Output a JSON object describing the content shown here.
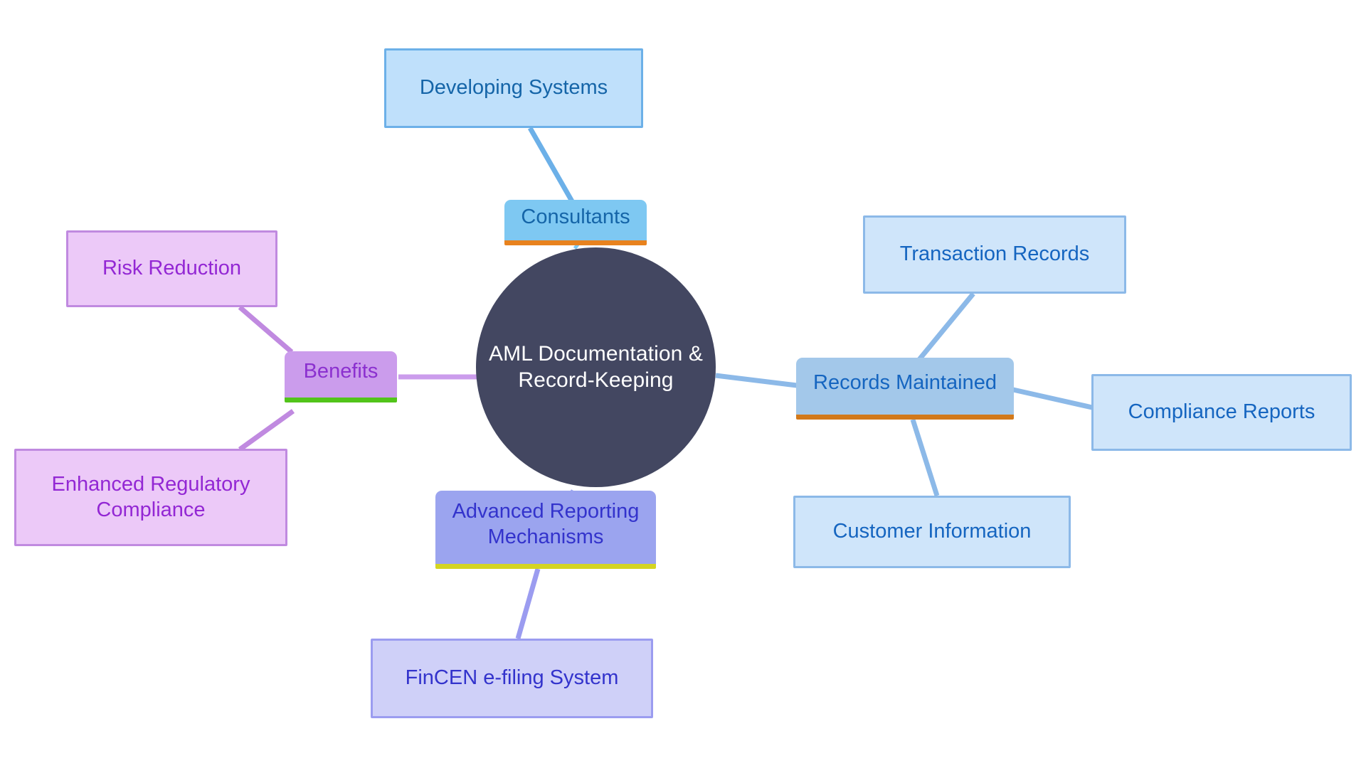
{
  "diagram": {
    "type": "mind-map",
    "background_color": "#ffffff",
    "root": {
      "id": "root",
      "label": "AML Documentation &\nRecord-Keeping",
      "shape": "circle",
      "fill": "#434761",
      "text_color": "#ffffff"
    },
    "branches": [
      {
        "id": "consultants",
        "label": "Consultants",
        "fill": "#7ec8f2",
        "text_color": "#1565a8",
        "accent_color": "#e8821e",
        "accent_position": "bottom",
        "children": [
          {
            "id": "developing-systems",
            "label": "Developing Systems",
            "fill": "#bfe0fb",
            "border_color": "#6cb0e8",
            "text_color": "#1565a8"
          }
        ]
      },
      {
        "id": "benefits",
        "label": "Benefits",
        "fill": "#cb9cec",
        "text_color": "#8b30cf",
        "accent_color": "#52c41a",
        "accent_position": "bottom",
        "children": [
          {
            "id": "risk-reduction",
            "label": "Risk Reduction",
            "fill": "#ecc9f8",
            "border_color": "#c08ae0",
            "text_color": "#9327d4"
          },
          {
            "id": "enhanced-regulatory-compliance",
            "label": "Enhanced Regulatory\nCompliance",
            "fill": "#ecc9f8",
            "border_color": "#c08ae0",
            "text_color": "#9327d4"
          }
        ]
      },
      {
        "id": "records-maintained",
        "label": "Records Maintained",
        "fill": "#a3c8ea",
        "text_color": "#1565c0",
        "accent_color": "#d2791b",
        "accent_position": "bottom",
        "children": [
          {
            "id": "transaction-records",
            "label": "Transaction Records",
            "fill": "#cfe5fa",
            "border_color": "#8cb9e8",
            "text_color": "#1565c0"
          },
          {
            "id": "compliance-reports",
            "label": "Compliance Reports",
            "fill": "#cfe5fa",
            "border_color": "#8cb9e8",
            "text_color": "#1565c0"
          },
          {
            "id": "customer-information",
            "label": "Customer Information",
            "fill": "#cfe5fa",
            "border_color": "#8cb9e8",
            "text_color": "#1565c0"
          }
        ]
      },
      {
        "id": "advanced-reporting-mechanisms",
        "label": "Advanced Reporting\nMechanisms",
        "fill": "#9ba4ef",
        "text_color": "#3333cc",
        "accent_color": "#d4d422",
        "accent_position": "bottom",
        "children": [
          {
            "id": "fincen-e-filing-system",
            "label": "FinCEN e-filing System",
            "fill": "#cfd0f8",
            "border_color": "#9b9cf0",
            "text_color": "#3333cc"
          }
        ]
      }
    ],
    "edges": [
      {
        "from": "root",
        "to": "consultants",
        "color": "#7ec8f2"
      },
      {
        "from": "consultants",
        "to": "developing-systems",
        "color": "#6cb0e8"
      },
      {
        "from": "root",
        "to": "benefits",
        "color": "#cb9cec"
      },
      {
        "from": "benefits",
        "to": "risk-reduction",
        "color": "#c08ae0"
      },
      {
        "from": "benefits",
        "to": "enhanced-regulatory-compliance",
        "color": "#c08ae0"
      },
      {
        "from": "root",
        "to": "records-maintained",
        "color": "#8cb9e8"
      },
      {
        "from": "records-maintained",
        "to": "transaction-records",
        "color": "#8cb9e8"
      },
      {
        "from": "records-maintained",
        "to": "compliance-reports",
        "color": "#8cb9e8"
      },
      {
        "from": "records-maintained",
        "to": "customer-information",
        "color": "#8cb9e8"
      },
      {
        "from": "root",
        "to": "advanced-reporting-mechanisms",
        "color": "#9ba4ef"
      },
      {
        "from": "advanced-reporting-mechanisms",
        "to": "fincen-e-filing-system",
        "color": "#9b9cf0"
      }
    ]
  }
}
